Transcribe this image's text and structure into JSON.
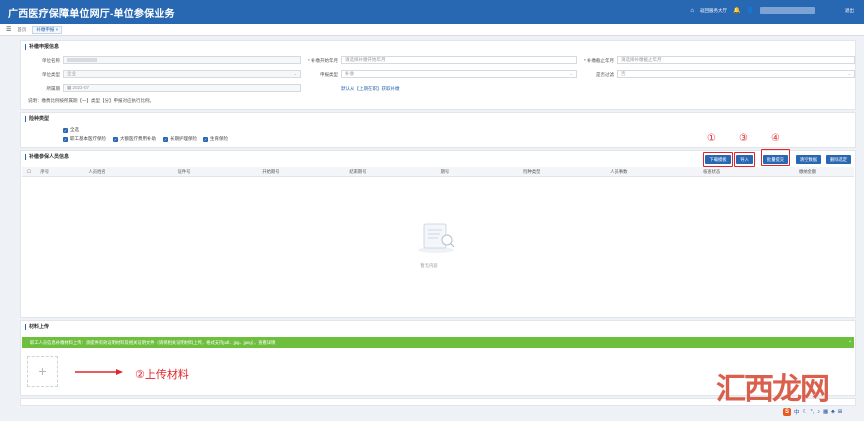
{
  "header": {
    "title": "广西医疗保障单位网厅-单位参保业务",
    "service_hall": "返回服务大厅",
    "logout": "退出"
  },
  "tabbar": {
    "home": "首页",
    "active_tab": "补缴申报"
  },
  "section1": {
    "title": "补缴申报信息",
    "unit_name_label": "单位名称",
    "start_label": "* 补缴开始年月",
    "start_placeholder": "请选择补缴开始年月",
    "end_label": "* 补缴截止年月",
    "end_placeholder": "请选择补缴截止年月",
    "unit_type_label": "单位类型",
    "unit_type_value": "企业",
    "dept_label": "申报类型",
    "dept_value": "补收",
    "all_label": "是否过滤",
    "all_value": "否",
    "period_label": "所属期",
    "period_value": "2022-07",
    "link_text": "默认从【上期在职】获取补缴",
    "note": "说明：缴费比例按所属期【一】类型【分】申报对应执行比例。"
  },
  "section2": {
    "title": "险种类型",
    "all": "全选",
    "items": [
      "职工基本医疗保险",
      "大额医疗费用补助",
      "长期护理保险",
      "生育保险"
    ]
  },
  "section3": {
    "title": "补缴参保人员信息",
    "buttons": [
      "下载模板",
      "导入",
      "批量提交",
      "清空数据",
      "删除选定"
    ],
    "columns": [
      "序号",
      "人员姓名",
      "证件号",
      "开始期号",
      "结束期号",
      "期号",
      "险种类型",
      "人员事数",
      "核查状态",
      "缴纳金额"
    ],
    "empty": "暂无内容"
  },
  "section4": {
    "title": "材料上传",
    "banner": "职工人员信息补缴材料上传：须提供有效证明材料及相关证明文件（请将相关证明材料上传，格式支持pdf、jpg、jpeg），查看详情"
  },
  "annotations": {
    "mark1": "①",
    "mark3": "③",
    "mark4": "④",
    "upload_text": "②上传材料"
  },
  "watermark": "汇西龙网",
  "ime": "中"
}
